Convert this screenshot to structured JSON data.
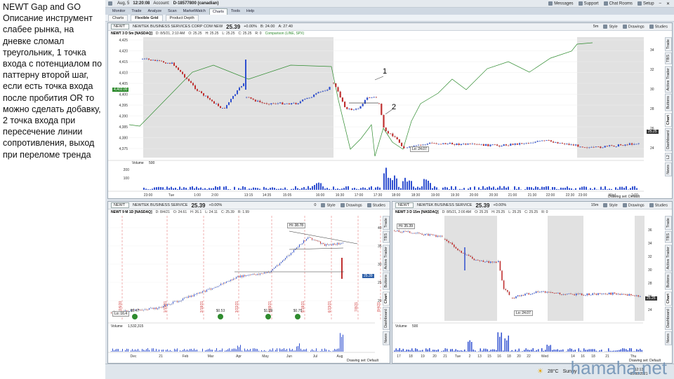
{
  "note": "NEWT Gap and GO Описание инструмент слабее рынка, на дневке сломал треугольник, 1 точка входа с потенциалом по паттерну второй шаг, если есть точка входа после пробития OR то можно сделать добавку, 2 точка  входа при пересечение линии сопротивления, выход при переломе тренда",
  "titlebar": {
    "date": "Aug, 5",
    "time": "12:20:08",
    "account_label": "Account:",
    "account": "D-18577800 (canadian)",
    "messages": "Messages",
    "support": "Support",
    "chat": "Chat Rooms",
    "setup": "Setup"
  },
  "menu": [
    "Monitor",
    "Trade",
    "Analyze",
    "Scan",
    "MarketWatch",
    "Charts",
    "Tools",
    "Help"
  ],
  "subtabs": [
    "Charts",
    "Flexible Grid",
    "Product Depth"
  ],
  "top": {
    "symbol": "NEWT",
    "company": "NEWTEK BUSINESS SERVICES CORP COM NEW",
    "price": "25.39",
    "chg": "+0.00%",
    "bid": "B: 24.00",
    "ask": "A: 27.40",
    "style": "Style",
    "drawings": "Drawings",
    "studies": "Studies",
    "range": "5m",
    "status": {
      "title": "NEWT 3 D 5m [NASDAQ]",
      "d": "D: 8/5/21, 2:10 AM",
      "o": "O: 25.25",
      "h": "H: 25.25",
      "l": "L: 25.25",
      "c": "C: 25.25",
      "r": "R: 0",
      "cmp": "Comparison (LINE, SPX)"
    },
    "yaxis": [
      "4,425",
      "4,420",
      "4,415",
      "4,410",
      "4,405",
      "4,400",
      "4,395",
      "4,390",
      "4,385",
      "4,380",
      "4,375"
    ],
    "ryaxis": [
      "34",
      "32",
      "30",
      "28",
      "26",
      "24"
    ],
    "spx_tag": "4,402.00",
    "price_tag": "25.25",
    "lo": "Lo: 24.07",
    "xaxis": [
      "23:00",
      "Tue",
      "1:00",
      "2:00",
      "13:15",
      "14:35",
      "15:05",
      "16:00",
      "16:30",
      "17:00",
      "17:30",
      "18:00",
      "18:30",
      "19:00",
      "19:30",
      "20:00",
      "20:30",
      "21:00",
      "21:30",
      "22:00",
      "22:30",
      "23:00",
      "Wed",
      "1:00"
    ],
    "volume_label": "Volume",
    "volume_val": "500",
    "vol_axis": [
      "200",
      "100"
    ],
    "annot1": "1",
    "annot2": "2",
    "tabs": [
      "Trade",
      "TBS",
      "Active Trader",
      "Buttons",
      "Chart",
      "Dashboard",
      "L2",
      "News"
    ],
    "drawing_set": "Drawing set: Default"
  },
  "bl": {
    "symbol": "NEWT",
    "company": "NEWTEK BUSINESS SERVICE",
    "price": "25.39",
    "chg": "+0.00%",
    "range": "0",
    "status": {
      "title": "NEWT 9 M 1D [NASDAQ]",
      "d": "D: 8/4/21",
      "o": "O: 24.61",
      "h": "H: 26.1",
      "l": "L: 24.11",
      "c": "C: 25.39",
      "r": "R: 1.99"
    },
    "hi": "Hi: 38.78",
    "lo": "Lo: 16.4",
    "price_tag": "25.39",
    "yaxis": [
      "40",
      "35",
      "30",
      "25",
      "20"
    ],
    "xaxis": [
      "Dec",
      "21",
      "Feb",
      "Mar",
      "Apr",
      "May",
      "Jun",
      "Jul",
      "Aug"
    ],
    "events": [
      "12/6/20",
      "1/15/21",
      "2/18/21",
      "3/22/21",
      "4/28/21",
      "5/18/21",
      "6/23/21",
      "7/8/21",
      "8/4/21"
    ],
    "divs": [
      "$0.47",
      "$0.53",
      "$1.09",
      "$0.75"
    ],
    "volume_label": "Volume",
    "volume_val": "1,532,315",
    "vol_axis": [
      "<thousan"
    ],
    "drawing_set": "Drawing set: Default",
    "tabs": [
      "Trade",
      "TBS",
      "Active Trader",
      "Buttons",
      "Chart",
      "Dashboard",
      "News"
    ]
  },
  "br": {
    "symbol": "NEWT",
    "company": "NEWTEK BUSINESS SERVICE",
    "price": "25.39",
    "chg": "+0.00%",
    "range": "15m",
    "status": {
      "title": "NEWT 3 D 15m [NASDAQ]",
      "d": "D: 8/5/21, 2:00 AM",
      "o": "O: 25.25",
      "h": "H: 25.25",
      "l": "L: 25.25",
      "c": "C: 25.25",
      "r": "R: 0"
    },
    "hi": "Hi: 35.39",
    "lo": "Lo: 24.07",
    "price_tag": "25.25",
    "yaxis": [
      "36",
      "34",
      "32",
      "30",
      "28",
      "26",
      "24"
    ],
    "xaxis": [
      "17",
      "18",
      "19",
      "20",
      "21",
      "Tue",
      "2",
      "13",
      "15",
      "16",
      "18",
      "20",
      "22",
      "Wed",
      "14",
      "16",
      "18",
      "21",
      "Thu"
    ],
    "volume_label": "Volume",
    "volume_val": "500",
    "vol_axis": [
      "<thousan"
    ],
    "drawing_set": "Drawing set: Default",
    "tabs": [
      "Trade",
      "TBS",
      "Active Trader",
      "Buttons",
      "Chart",
      "Dashboard",
      "News"
    ]
  },
  "taskbar": {
    "temp": "28°C",
    "weather": "Sunny",
    "time": "12:13",
    "date": "05.08.2021"
  },
  "watermark": "hamaha.net",
  "colors": {
    "up": "#3050d0",
    "down": "#c03030",
    "line": "#2e8b2e",
    "shade": "#c8c8c8"
  }
}
